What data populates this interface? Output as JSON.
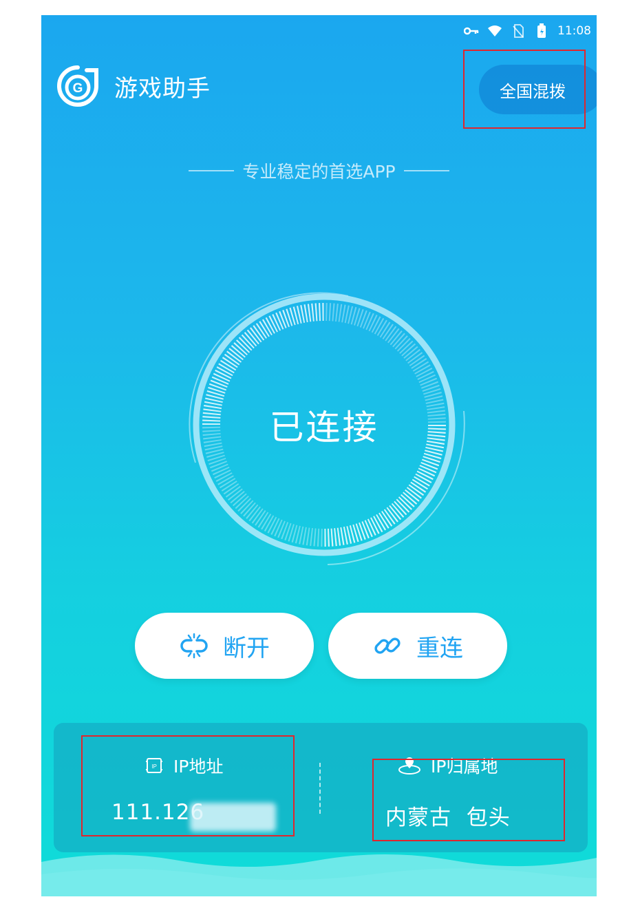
{
  "status_bar": {
    "time": "11:08",
    "icons": [
      "key-icon",
      "wifi-icon",
      "no-sim-icon",
      "battery-icon"
    ]
  },
  "header": {
    "app_title": "游戏助手",
    "logo": "g-shield-logo"
  },
  "region_button": {
    "label": "全国混拨"
  },
  "tagline": "专业稳定的首选APP",
  "dial": {
    "status_text": "已连接"
  },
  "actions": {
    "disconnect_label": "断开",
    "reconnect_label": "重连"
  },
  "info": {
    "ip_label": "IP地址",
    "ip_value": "111.126",
    "location_label": "IP归属地",
    "location_value": "内蒙古  包头"
  },
  "colors": {
    "accent": "#21a4f2",
    "highlight": "#e0262d"
  }
}
